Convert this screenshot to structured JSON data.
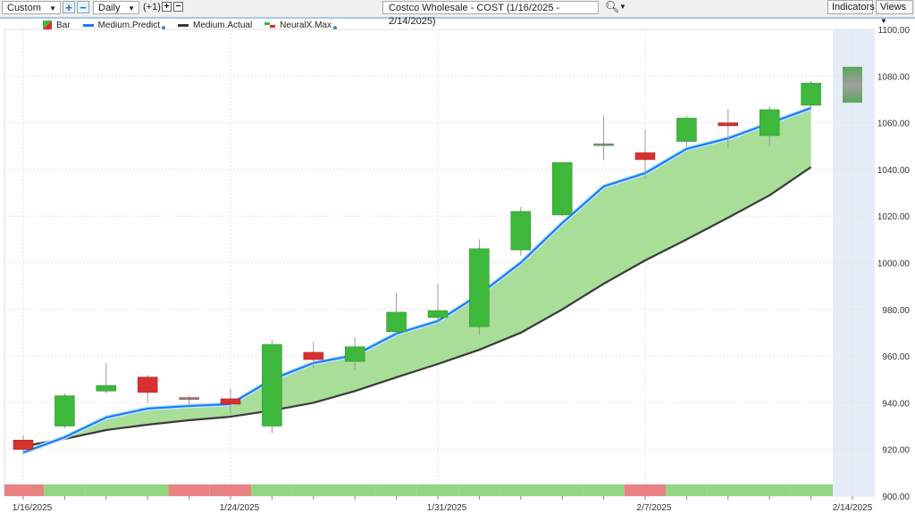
{
  "toolbar": {
    "range_select": "Custom",
    "interval_select": "Daily",
    "offset_label": "(+1)",
    "symbol_field": "Costco Wholesale - COST (1/16/2025 - 2/14/2025)",
    "indicators_label": "Indicators",
    "views_label": "Views",
    "plus": "+",
    "minus": "−"
  },
  "legend": {
    "bar": "Bar",
    "predict": "Medium.Predict",
    "actual": "Medium.Actual",
    "neural": "NeuralX.Max"
  },
  "colors": {
    "up": "#3db83a",
    "down": "#d93030",
    "predict": "#1a7cf5",
    "actual": "#3a3a3a",
    "fill": "#a3dc92",
    "signal_up": "#93d680",
    "signal_down": "#e88282",
    "forecast_bg": "#e4edf8"
  },
  "chart_data": {
    "type": "candlestick",
    "ylim": [
      900,
      1100
    ],
    "yticks": [
      900,
      920,
      940,
      960,
      980,
      1000,
      1020,
      1040,
      1060,
      1080,
      1100
    ],
    "xlabels": [
      {
        "index": 0,
        "label": "1/16/2025"
      },
      {
        "index": 5,
        "label": "1/24/2025"
      },
      {
        "index": 10,
        "label": "1/31/2025"
      },
      {
        "index": 15,
        "label": "2/7/2025"
      },
      {
        "index": 20,
        "label": "2/14/2025"
      }
    ],
    "candles": [
      {
        "o": 924,
        "h": 926,
        "l": 918,
        "c": 920
      },
      {
        "o": 930,
        "h": 944,
        "l": 929,
        "c": 943
      },
      {
        "o": 945,
        "h": 957,
        "l": 944,
        "c": 947.4
      },
      {
        "o": 951,
        "h": 952,
        "l": 940,
        "c": 944.4
      },
      {
        "o": 942.2,
        "h": 943,
        "l": 938,
        "c": 941.8
      },
      {
        "o": 941.7,
        "h": 946,
        "l": 935,
        "c": 939.4
      },
      {
        "o": 930,
        "h": 967,
        "l": 927,
        "c": 965
      },
      {
        "o": 961.6,
        "h": 966,
        "l": 955,
        "c": 958.5
      },
      {
        "o": 957.7,
        "h": 968,
        "l": 954,
        "c": 964
      },
      {
        "o": 970.4,
        "h": 987,
        "l": 969,
        "c": 978.8
      },
      {
        "o": 976.5,
        "h": 991,
        "l": 975,
        "c": 979.5
      },
      {
        "o": 972.6,
        "h": 1010,
        "l": 969,
        "c": 1006
      },
      {
        "o": 1005.5,
        "h": 1024,
        "l": 1003,
        "c": 1022
      },
      {
        "o": 1020.5,
        "h": 1043,
        "l": 1020,
        "c": 1043
      },
      {
        "o": 1050.6,
        "h": 1063,
        "l": 1044,
        "c": 1051
      },
      {
        "o": 1047.2,
        "h": 1057,
        "l": 1036,
        "c": 1044.2
      },
      {
        "o": 1052,
        "h": 1063,
        "l": 1050,
        "c": 1062
      },
      {
        "o": 1060,
        "h": 1066,
        "l": 1049,
        "c": 1058.7
      },
      {
        "o": 1054.5,
        "h": 1067,
        "l": 1050,
        "c": 1065.6
      },
      {
        "o": 1067.5,
        "h": 1078,
        "l": 1066,
        "c": 1077
      }
    ],
    "forecast_box": {
      "low": 1068.6,
      "high": 1084
    },
    "series": [
      {
        "name": "Medium.Predict",
        "values": [
          918.7,
          925.2,
          933.7,
          937.5,
          938.6,
          939.4,
          950,
          957,
          960.4,
          969.6,
          975,
          986.4,
          1000,
          1017,
          1032.7,
          1038.4,
          1048.8,
          1053.3,
          1059.8,
          1066.3
        ]
      },
      {
        "name": "Medium.Actual",
        "values": [
          921.4,
          924.5,
          928.3,
          930.6,
          932.5,
          934,
          936.7,
          940,
          945,
          950.9,
          956.6,
          962.7,
          970,
          980,
          991,
          1001,
          1010,
          1019.3,
          1028.9,
          1041
        ]
      }
    ],
    "signals": [
      "down",
      "up",
      "up",
      "up",
      "down",
      "down",
      "up",
      "up",
      "up",
      "up",
      "up",
      "up",
      "up",
      "up",
      "up",
      "down",
      "up",
      "up",
      "up",
      "up"
    ]
  }
}
